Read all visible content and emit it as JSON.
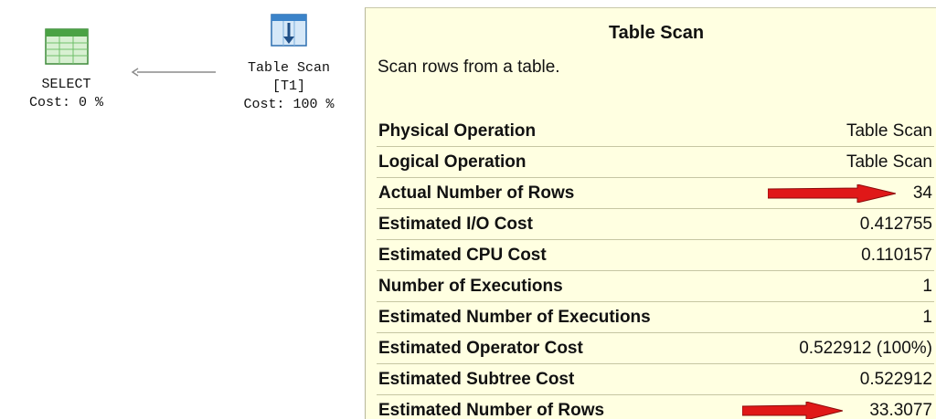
{
  "plan": {
    "select_node": {
      "name": "SELECT",
      "cost": "Cost: 0 %",
      "icon": "select-result-grid-icon"
    },
    "scan_node": {
      "name": "Table Scan",
      "table": "[T1]",
      "cost": "Cost: 100 %",
      "icon": "table-scan-icon"
    }
  },
  "tooltip": {
    "title": "Table Scan",
    "description": "Scan rows from a table.",
    "rows": [
      {
        "label": "Physical Operation",
        "value": "Table Scan"
      },
      {
        "label": "Logical Operation",
        "value": "Table Scan"
      },
      {
        "label": "Actual Number of Rows",
        "value": "34",
        "highlighted": true
      },
      {
        "label": "Estimated I/O Cost",
        "value": "0.412755"
      },
      {
        "label": "Estimated CPU Cost",
        "value": "0.110157"
      },
      {
        "label": "Number of Executions",
        "value": "1"
      },
      {
        "label": "Estimated Number of Executions",
        "value": "1"
      },
      {
        "label": "Estimated Operator Cost",
        "value": "0.522912 (100%)"
      },
      {
        "label": "Estimated Subtree Cost",
        "value": "0.522912"
      },
      {
        "label": "Estimated Number of Rows",
        "value": "33.3077",
        "highlighted": true
      }
    ]
  },
  "colors": {
    "tooltip_background": "#ffffe1",
    "highlight_arrow": "#e01818",
    "grid_icon_green": "#6fbf6a",
    "scan_icon_blue": "#3b83c9"
  }
}
